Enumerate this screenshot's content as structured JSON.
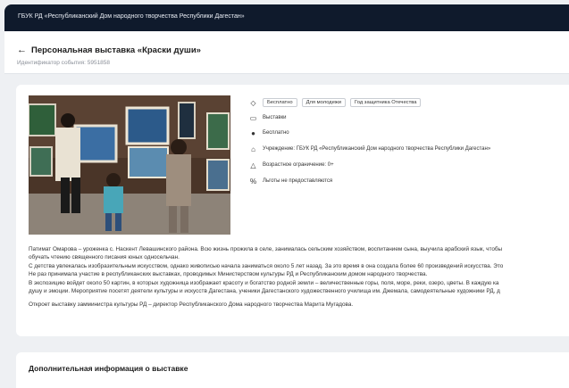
{
  "topbar": {
    "org": "ГБУК РД «Республиканский Дом народного творчества Республики Дагестан»"
  },
  "header": {
    "back_icon": "arrow-left-icon",
    "title": "Персональная выставка «Краски души»",
    "event_id": "Идентификатор события: 5951858"
  },
  "meta": {
    "tags": [
      "Бесплатно",
      "Для молодежи",
      "Год защитника Отечества"
    ],
    "category": "Выставки",
    "price": "Бесплатно",
    "institution": "Учреждение: ГБУК РД «Республиканский Дом народного творчества Республики Дагестан»",
    "age": "Возрастное ограничение: 0+",
    "benefits": "Льготы не предоставляются"
  },
  "description": [
    "Патимат Омарова – уроженка с. Наскент Левашинского района. Всю жизнь прожила в селе, занималась сельским хозяйством, воспитанием сына, выучила арабский язык, чтобы",
    "обучать чтению священного писания юных односельчан.",
    "С детства увлекалась изобразительным искусством, однако живописью начала заниматься около 5 лет назад. За это время в она создала более 60 произведений искусства. Это",
    "Не раз принимала участие в республиканских выставках, проводимых Министерством культуры РД и Республиканским домом народного творчества.",
    "В экспозицию войдет около 50 картин, в которых художница изображает красоту и богатство родной земли – величественные горы, поля, море, реки, озеро, цветы. В каждую ка",
    "душу и эмоции. Мероприятие посетят деятели культуры и искусств Дагестана, ученики Дагестанского художественного училища им. Джемала, самодеятельные художники РД, д",
    "Откроет выставку замминистра культуры РД – директор Республиканского Дома народного творчества Марита Мугадова."
  ],
  "additional": {
    "title": "Дополнительная информация о выставке"
  },
  "icons": {
    "tags": "tag-icon",
    "category": "folder-icon",
    "price": "ruble-icon",
    "institution": "building-icon",
    "age": "warning-icon",
    "benefits": "percent-icon"
  }
}
